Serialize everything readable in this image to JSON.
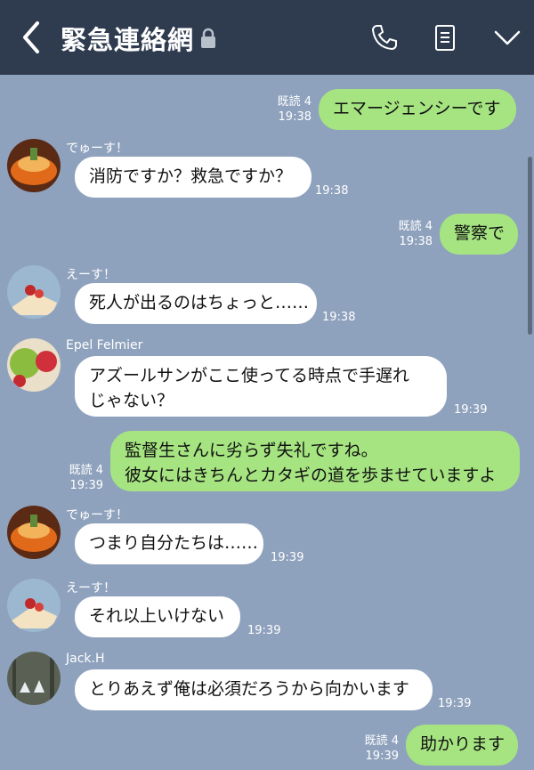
{
  "header": {
    "title": "緊急連絡網",
    "icons": [
      "back-chevron-icon",
      "lock-icon",
      "phone-icon",
      "notes-icon",
      "chevron-down-icon"
    ]
  },
  "messages": [
    {
      "dir": "out",
      "text": "エマージェンシーです",
      "read": "既読 4",
      "time": "19:38"
    },
    {
      "dir": "in",
      "sender": "でゅーす！",
      "text": "消防ですか？救急ですか？",
      "time": "19:38"
    },
    {
      "dir": "out",
      "text": "警察で",
      "read": "既読 4",
      "time": "19:38"
    },
    {
      "dir": "in",
      "sender": "えーす！",
      "text": "死人が出るのはちょっと……",
      "time": "19:38"
    },
    {
      "dir": "in",
      "sender": "Epel Felmier",
      "text_lines": [
        "アズールサンがここ使ってる時点で手遅れ",
        "じゃない？"
      ],
      "time": "19:39"
    },
    {
      "dir": "out",
      "text_lines": [
        "監督生さんに劣らず失礼ですね。",
        "彼女にはきちんとカタギの道を歩ませていますよ"
      ],
      "read": "既読 4",
      "time": "19:39"
    },
    {
      "dir": "in",
      "sender": "でゅーす！",
      "text": "つまり自分たちは……",
      "time": "19:39"
    },
    {
      "dir": "in",
      "sender": "えーす！",
      "text": "それ以上いけない",
      "time": "19:39"
    },
    {
      "dir": "in",
      "sender": "Jack.H",
      "text": "とりあえず俺は必須だろうから向かいます",
      "time": "19:39"
    },
    {
      "dir": "out",
      "text": "助かります",
      "read": "既読 4",
      "time": "19:39"
    }
  ],
  "colors": {
    "header_bg": "#2f3b4f",
    "chat_bg": "#8fa2bd",
    "out_bubble": "#a5e481",
    "in_bubble": "#ffffff"
  }
}
